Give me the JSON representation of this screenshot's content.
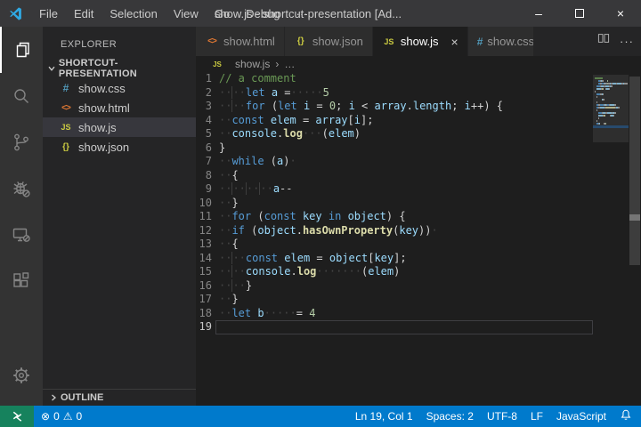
{
  "title_bar": {
    "menus": [
      "File",
      "Edit",
      "Selection",
      "View",
      "Go",
      "Debug",
      "···"
    ],
    "title": "show.js - shortcut-presentation [Ad...",
    "controls": {
      "minimize": "–",
      "maximize": "maximize-box",
      "close": "×"
    }
  },
  "activity_bar": {
    "items": [
      {
        "name": "explorer",
        "icon": "files-icon",
        "active": true
      },
      {
        "name": "search",
        "icon": "search-icon",
        "active": false
      },
      {
        "name": "source-control",
        "icon": "branch-icon",
        "active": false
      },
      {
        "name": "debug",
        "icon": "bug-disabled-icon",
        "active": false
      },
      {
        "name": "remote-explorer",
        "icon": "monitor-disabled-icon",
        "active": false
      },
      {
        "name": "extensions",
        "icon": "extensions-icon",
        "active": false
      },
      {
        "name": "manage",
        "icon": "gear-icon",
        "active": false
      }
    ]
  },
  "sidebar": {
    "header": "EXPLORER",
    "section": "SHORTCUT-PRESENTATION",
    "files": [
      {
        "icon": "css-icon",
        "icon_text": "#",
        "label": "show.css",
        "selected": false
      },
      {
        "icon": "html-icon",
        "icon_text": "<>",
        "label": "show.html",
        "selected": false
      },
      {
        "icon": "js-icon",
        "icon_text": "JS",
        "label": "show.js",
        "selected": true
      },
      {
        "icon": "json-icon",
        "icon_text": "{}",
        "label": "show.json",
        "selected": false
      }
    ],
    "outline_label": "OUTLINE"
  },
  "tabs": [
    {
      "icon_text": "<>",
      "label": "show.html",
      "active": false
    },
    {
      "icon_text": "{}",
      "label": "show.json",
      "active": false
    },
    {
      "icon_text": "JS",
      "label": "show.js",
      "active": true,
      "close": "×"
    },
    {
      "icon_text": "#",
      "label": "show.css",
      "active": false
    }
  ],
  "tab_actions": {
    "split_editor": "split-editor-icon",
    "more": "···"
  },
  "breadcrumb": {
    "icon_text": "JS",
    "file": "show.js",
    "separator": "›",
    "more": "…"
  },
  "editor": {
    "active_line": 19,
    "lines": [
      {
        "n": 1,
        "tokens": [
          {
            "t": "// a comment",
            "c": "cm"
          }
        ]
      },
      {
        "n": 2,
        "tokens": [
          {
            "t": "··",
            "c": "ws"
          },
          {
            "t": "··",
            "c": "wsg"
          },
          {
            "t": "let",
            "c": "kw"
          },
          {
            "t": " ",
            "c": "p"
          },
          {
            "t": "a",
            "c": "v"
          },
          {
            "t": " =",
            "c": "p"
          },
          {
            "t": "·····",
            "c": "ws"
          },
          {
            "t": "5",
            "c": "n"
          }
        ]
      },
      {
        "n": 3,
        "tokens": [
          {
            "t": "··",
            "c": "ws"
          },
          {
            "t": "··",
            "c": "wsg"
          },
          {
            "t": "for",
            "c": "kw"
          },
          {
            "t": " (",
            "c": "p"
          },
          {
            "t": "let",
            "c": "kw"
          },
          {
            "t": " ",
            "c": "p"
          },
          {
            "t": "i",
            "c": "v"
          },
          {
            "t": " = ",
            "c": "p"
          },
          {
            "t": "0",
            "c": "n"
          },
          {
            "t": "; ",
            "c": "p"
          },
          {
            "t": "i",
            "c": "v"
          },
          {
            "t": " < ",
            "c": "p"
          },
          {
            "t": "array",
            "c": "v"
          },
          {
            "t": ".",
            "c": "p"
          },
          {
            "t": "length",
            "c": "v"
          },
          {
            "t": "; ",
            "c": "p"
          },
          {
            "t": "i",
            "c": "v"
          },
          {
            "t": "++) {",
            "c": "p"
          }
        ]
      },
      {
        "n": 4,
        "tokens": [
          {
            "t": "··",
            "c": "ws"
          },
          {
            "t": "const",
            "c": "kw"
          },
          {
            "t": " ",
            "c": "p"
          },
          {
            "t": "elem",
            "c": "v"
          },
          {
            "t": " = ",
            "c": "p"
          },
          {
            "t": "array",
            "c": "v"
          },
          {
            "t": "[",
            "c": "p"
          },
          {
            "t": "i",
            "c": "v"
          },
          {
            "t": "];",
            "c": "p"
          }
        ]
      },
      {
        "n": 5,
        "tokens": [
          {
            "t": "··",
            "c": "ws"
          },
          {
            "t": "console",
            "c": "v"
          },
          {
            "t": ".",
            "c": "p"
          },
          {
            "t": "log",
            "c": "fn"
          },
          {
            "t": "···",
            "c": "ws"
          },
          {
            "t": "(",
            "c": "p"
          },
          {
            "t": "elem",
            "c": "v"
          },
          {
            "t": ")",
            "c": "p"
          }
        ]
      },
      {
        "n": 6,
        "tokens": [
          {
            "t": "}",
            "c": "p"
          }
        ]
      },
      {
        "n": 7,
        "tokens": [
          {
            "t": "··",
            "c": "ws"
          },
          {
            "t": "while",
            "c": "kw"
          },
          {
            "t": " (",
            "c": "p"
          },
          {
            "t": "a",
            "c": "v"
          },
          {
            "t": ")",
            "c": "p"
          },
          {
            "t": "·",
            "c": "ws"
          }
        ]
      },
      {
        "n": 8,
        "tokens": [
          {
            "t": "··",
            "c": "ws"
          },
          {
            "t": "{",
            "c": "p"
          }
        ]
      },
      {
        "n": 9,
        "tokens": [
          {
            "t": "··",
            "c": "ws"
          },
          {
            "t": "··",
            "c": "wsg"
          },
          {
            "t": "··",
            "c": "wsg"
          },
          {
            "t": "··",
            "c": "wsg"
          },
          {
            "t": "a",
            "c": "v"
          },
          {
            "t": "--",
            "c": "p"
          }
        ]
      },
      {
        "n": 10,
        "tokens": [
          {
            "t": "··",
            "c": "ws"
          },
          {
            "t": "}",
            "c": "p"
          }
        ]
      },
      {
        "n": 11,
        "tokens": [
          {
            "t": "··",
            "c": "ws"
          },
          {
            "t": "for",
            "c": "kw"
          },
          {
            "t": " (",
            "c": "p"
          },
          {
            "t": "const",
            "c": "kw"
          },
          {
            "t": " ",
            "c": "p"
          },
          {
            "t": "key",
            "c": "v"
          },
          {
            "t": " ",
            "c": "p"
          },
          {
            "t": "in",
            "c": "kw"
          },
          {
            "t": " ",
            "c": "p"
          },
          {
            "t": "object",
            "c": "v"
          },
          {
            "t": ") {",
            "c": "p"
          }
        ]
      },
      {
        "n": 12,
        "tokens": [
          {
            "t": "··",
            "c": "ws"
          },
          {
            "t": "if",
            "c": "kw"
          },
          {
            "t": " (",
            "c": "p"
          },
          {
            "t": "object",
            "c": "v"
          },
          {
            "t": ".",
            "c": "p"
          },
          {
            "t": "hasOwnProperty",
            "c": "fn"
          },
          {
            "t": "(",
            "c": "p"
          },
          {
            "t": "key",
            "c": "v"
          },
          {
            "t": "))",
            "c": "p"
          },
          {
            "t": "·",
            "c": "ws"
          }
        ]
      },
      {
        "n": 13,
        "tokens": [
          {
            "t": "··",
            "c": "ws"
          },
          {
            "t": "{",
            "c": "p"
          }
        ]
      },
      {
        "n": 14,
        "tokens": [
          {
            "t": "··",
            "c": "ws"
          },
          {
            "t": "··",
            "c": "wsg"
          },
          {
            "t": "const",
            "c": "kw"
          },
          {
            "t": " ",
            "c": "p"
          },
          {
            "t": "elem",
            "c": "v"
          },
          {
            "t": " = ",
            "c": "p"
          },
          {
            "t": "object",
            "c": "v"
          },
          {
            "t": "[",
            "c": "p"
          },
          {
            "t": "key",
            "c": "v"
          },
          {
            "t": "];",
            "c": "p"
          }
        ]
      },
      {
        "n": 15,
        "tokens": [
          {
            "t": "··",
            "c": "ws"
          },
          {
            "t": "··",
            "c": "wsg"
          },
          {
            "t": "console",
            "c": "v"
          },
          {
            "t": ".",
            "c": "p"
          },
          {
            "t": "log",
            "c": "fn"
          },
          {
            "t": "·······",
            "c": "ws"
          },
          {
            "t": "(",
            "c": "p"
          },
          {
            "t": "elem",
            "c": "v"
          },
          {
            "t": ")",
            "c": "p"
          }
        ]
      },
      {
        "n": 16,
        "tokens": [
          {
            "t": "··",
            "c": "ws"
          },
          {
            "t": "··",
            "c": "wsg"
          },
          {
            "t": "}",
            "c": "p"
          }
        ]
      },
      {
        "n": 17,
        "tokens": [
          {
            "t": "··",
            "c": "ws"
          },
          {
            "t": "}",
            "c": "p"
          }
        ]
      },
      {
        "n": 18,
        "tokens": [
          {
            "t": "··",
            "c": "ws"
          },
          {
            "t": "let",
            "c": "kw"
          },
          {
            "t": " ",
            "c": "p"
          },
          {
            "t": "b",
            "c": "v"
          },
          {
            "t": "·····",
            "c": "ws"
          },
          {
            "t": "= ",
            "c": "p"
          },
          {
            "t": "4",
            "c": "n"
          }
        ]
      },
      {
        "n": 19,
        "tokens": []
      }
    ]
  },
  "status_bar": {
    "errors": "0",
    "warnings": "0",
    "error_icon": "⊗",
    "warning_icon": "⚠",
    "right": [
      "Ln 19, Col 1",
      "Spaces: 2",
      "UTF-8",
      "LF",
      "JavaScript"
    ],
    "bell_icon": "bell-icon",
    "remote_icon": "remote-indicator-icon"
  },
  "colors": {
    "status_bar": "#007acc",
    "remote": "#16825d",
    "editor_bg": "#1e1e1e",
    "sidebar_bg": "#252526",
    "activity_bg": "#333333",
    "title_bg": "#38383a",
    "selection_row": "#37373d",
    "keyword": "#569cd6",
    "variable": "#9cdcfe",
    "function": "#dcdcaa",
    "number": "#b5cea8",
    "comment": "#6a9955",
    "css_icon": "#519aba",
    "html_icon": "#e37933",
    "js_icon": "#cbcb41"
  }
}
